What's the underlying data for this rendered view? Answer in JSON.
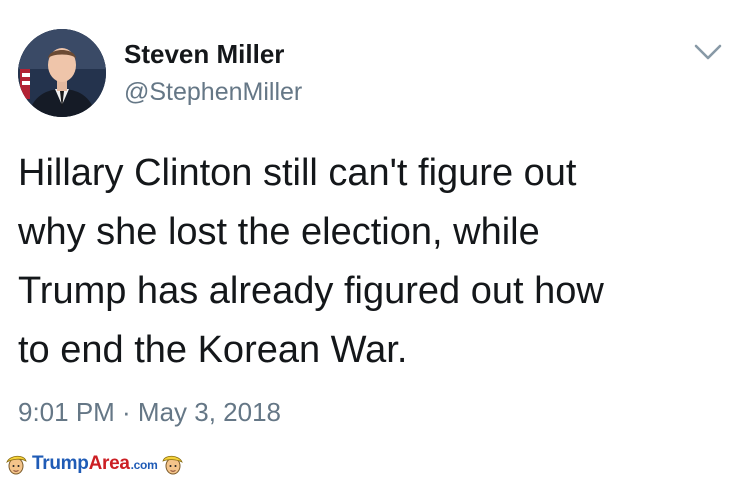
{
  "author": {
    "display_name": "Steven Miller",
    "handle": "@StephenMiller",
    "avatar_icon": "profile-photo"
  },
  "tweet": {
    "text": "Hillary Clinton still can't figure out\nwhy she lost the election, while\nTrump has already figured out how\nto end the Korean War.",
    "timestamp": "9:01 PM · May 3, 2018"
  },
  "menu": {
    "caret_icon": "chevron-down-icon"
  },
  "watermark": {
    "part1": "Trump",
    "part2": "Area",
    "part3": ".com"
  },
  "colors": {
    "text_primary": "#14171a",
    "text_secondary": "#657786",
    "watermark_blue": "#1f5bb6",
    "watermark_red": "#cc1f24"
  }
}
